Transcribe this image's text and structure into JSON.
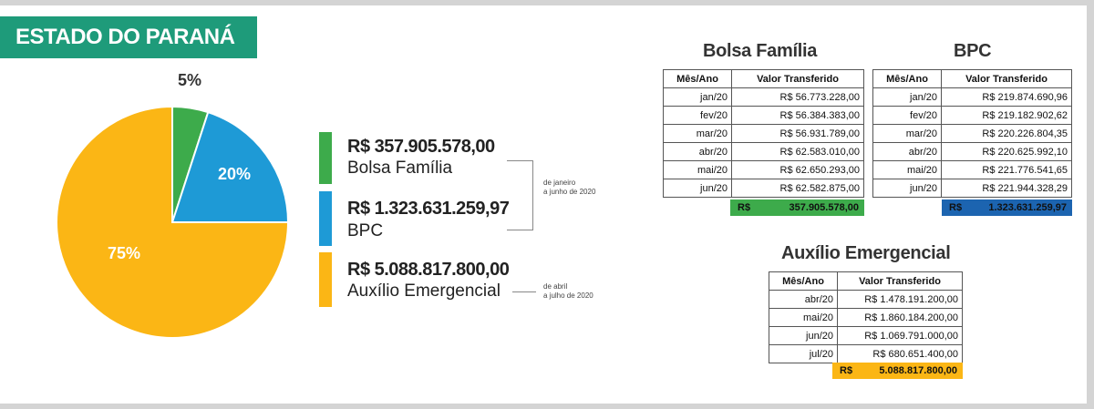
{
  "title": "ESTADO DO PARANÁ",
  "colors": {
    "bolsa": "#3dab4b",
    "bpc": "#1e9ad6",
    "auxilio": "#fbb615",
    "banner": "#1e9b7a",
    "bpc_total": "#1c64b0"
  },
  "chart_data": {
    "type": "pie",
    "slices": [
      {
        "label": "Bolsa Família",
        "percent": 5,
        "display": "5%"
      },
      {
        "label": "BPC",
        "percent": 20,
        "display": "20%"
      },
      {
        "label": "Auxílio Emergencial",
        "percent": 75,
        "display": "75%"
      }
    ]
  },
  "legend": [
    {
      "amount": "R$ 357.905.578,00",
      "name": "Bolsa Família"
    },
    {
      "amount": "R$ 1.323.631.259,97",
      "name": "BPC"
    },
    {
      "amount": "R$ 5.088.817.800,00",
      "name": "Auxílio Emergencial"
    }
  ],
  "periods": {
    "p1": [
      "de janeiro",
      "a junho de 2020"
    ],
    "p2": [
      "de abril",
      "a julho de 2020"
    ]
  },
  "tables": {
    "bolsa": {
      "title": "Bolsa Família",
      "headers": [
        "Mês/Ano",
        "Valor Transferido"
      ],
      "rows": [
        [
          "jan/20",
          "R$ 56.773.228,00"
        ],
        [
          "fev/20",
          "R$ 56.384.383,00"
        ],
        [
          "mar/20",
          "R$ 56.931.789,00"
        ],
        [
          "abr/20",
          "R$ 62.583.010,00"
        ],
        [
          "mai/20",
          "R$ 62.650.293,00"
        ],
        [
          "jun/20",
          "R$ 62.582.875,00"
        ]
      ],
      "total_currency": "R$",
      "total_value": "357.905.578,00"
    },
    "bpc": {
      "title": "BPC",
      "headers": [
        "Mês/Ano",
        "Valor Transferido"
      ],
      "rows": [
        [
          "jan/20",
          "R$ 219.874.690,96"
        ],
        [
          "fev/20",
          "R$ 219.182.902,62"
        ],
        [
          "mar/20",
          "R$ 220.226.804,35"
        ],
        [
          "abr/20",
          "R$ 220.625.992,10"
        ],
        [
          "mai/20",
          "R$ 221.776.541,65"
        ],
        [
          "jun/20",
          "R$ 221.944.328,29"
        ]
      ],
      "total_currency": "R$",
      "total_value": "1.323.631.259,97"
    },
    "auxilio": {
      "title": "Auxílio Emergencial",
      "headers": [
        "Mês/Ano",
        "Valor Transferido"
      ],
      "rows": [
        [
          "abr/20",
          "R$ 1.478.191.200,00"
        ],
        [
          "mai/20",
          "R$ 1.860.184.200,00"
        ],
        [
          "jun/20",
          "R$ 1.069.791.000,00"
        ],
        [
          "jul/20",
          "R$ 680.651.400,00"
        ]
      ],
      "total_currency": "R$",
      "total_value": "5.088.817.800,00"
    }
  }
}
